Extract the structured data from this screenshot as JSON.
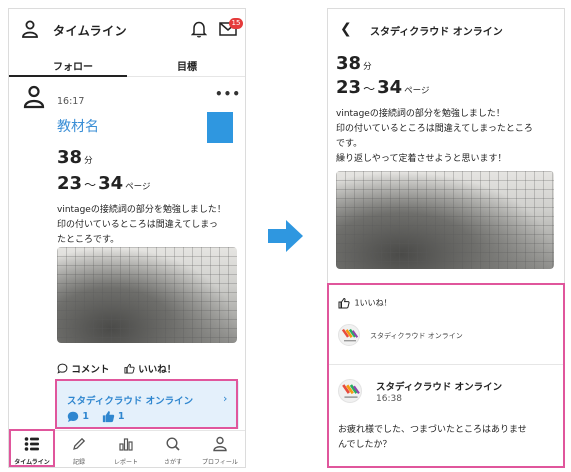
{
  "left": {
    "header": {
      "title": "タイムライン",
      "notification_badge": "15"
    },
    "tabs": [
      {
        "label": "フォロー"
      },
      {
        "label": "目標"
      }
    ],
    "post": {
      "time": "16:17",
      "material_name": "教材名",
      "minutes_value": "38",
      "minutes_unit": "分",
      "pages_from": "23",
      "pages_sep": "～",
      "pages_to": "34",
      "pages_unit": "ページ",
      "text": "vintageの接続詞の部分を勉強しました！\n印の付いているところは間違えてしまっ\nたところです。",
      "comment_label": "コメント",
      "like_label": "いいね！",
      "community": {
        "name": "スタディクラウド オンライン",
        "chevron": "›",
        "comment_count": "1",
        "like_count": "1"
      }
    },
    "bottom_nav": [
      {
        "label": "タイムライン",
        "icon": "timeline-icon"
      },
      {
        "label": "記録",
        "icon": "pen-icon"
      },
      {
        "label": "レポート",
        "icon": "chart-icon"
      },
      {
        "label": "さがす",
        "icon": "search-icon"
      },
      {
        "label": "プロフィール",
        "icon": "profile-icon"
      }
    ]
  },
  "right": {
    "header": {
      "title": "スタディクラウド オンライン"
    },
    "post": {
      "minutes_value": "38",
      "minutes_unit": "分",
      "pages_from": "23",
      "pages_sep": "～",
      "pages_to": "34",
      "pages_unit": "ページ",
      "text": "vintageの接続詞の部分を勉強しました！\n印の付いているところは間違えてしまったところ\nです。\n繰り返しやって定着させようと思います！"
    },
    "likes": {
      "summary": "1いいね！",
      "liker_name": "スタディクラウド オンライン"
    },
    "comment": {
      "author": "スタディクラウド オンライン",
      "time": "16:38",
      "text": "お疲れ様でした、つまづいたところはありませ\nんでしたか？"
    }
  },
  "colors": {
    "accent_blue": "#2f86cf",
    "highlight_pink": "#e0569c",
    "badge_red": "#e53b3b",
    "arrow_blue": "#2f97e0"
  }
}
